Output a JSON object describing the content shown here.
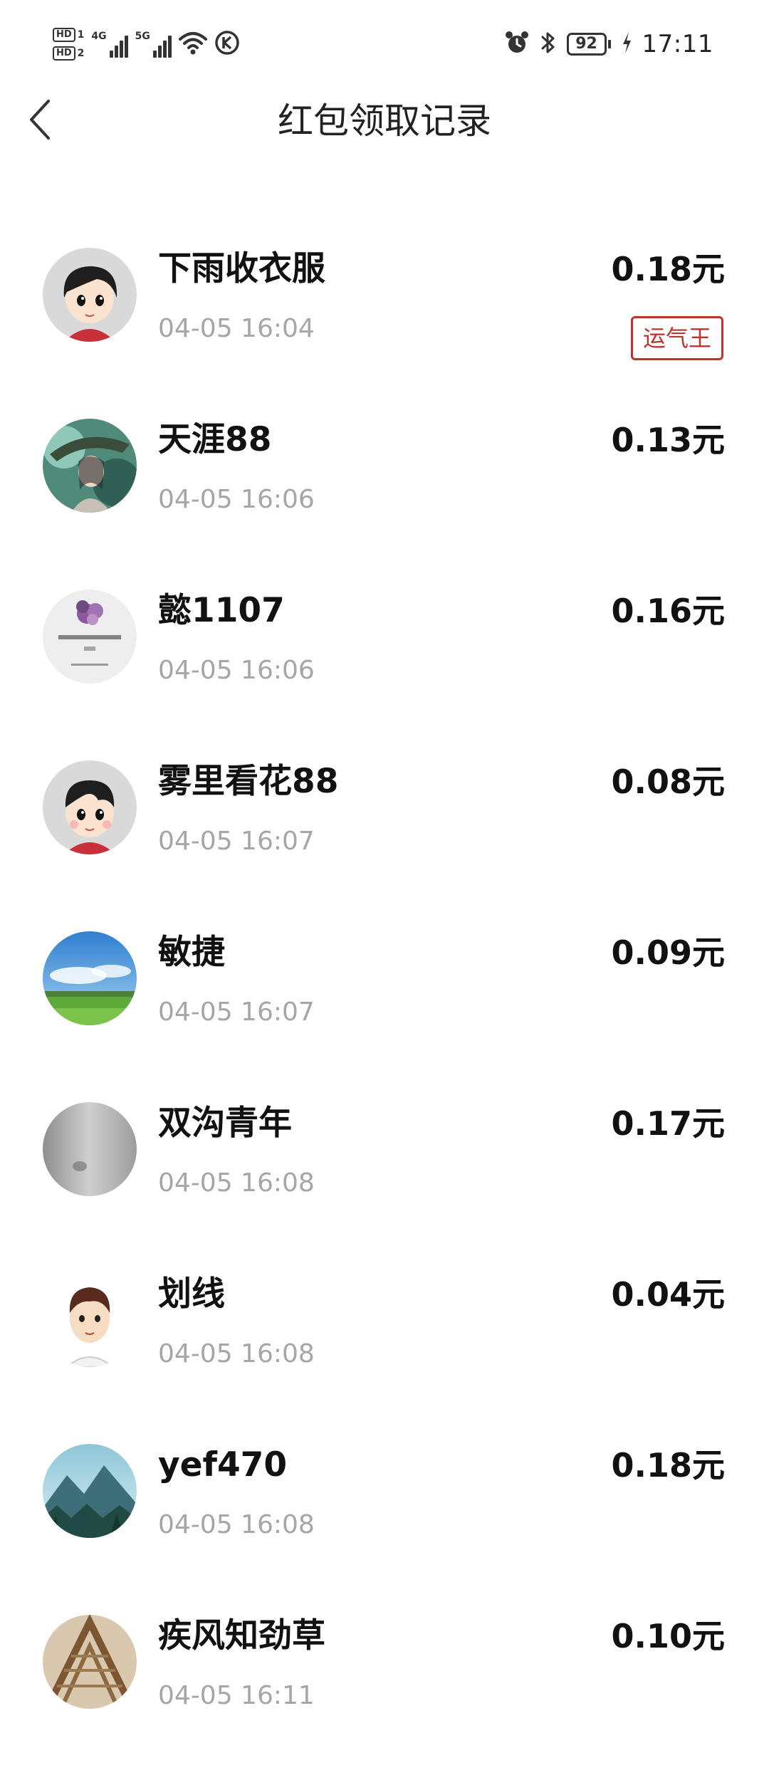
{
  "status_bar": {
    "sim1_label": "HD",
    "sim1_index": "1",
    "sim2_label": "HD",
    "sim2_index": "2",
    "net_4g": "4G",
    "net_5g": "5G",
    "battery_level": "92",
    "time": "17:11"
  },
  "header": {
    "title": "红包领取记录"
  },
  "colors": {
    "badge_red": "#c0322e",
    "time_gray": "#a6a6a6",
    "text_dark": "#111111"
  },
  "records": [
    {
      "name": "下雨收衣服",
      "time": "04-05 16:04",
      "amount": "0.18元",
      "badge": "运气王",
      "avatar": "cartoon-girl"
    },
    {
      "name": "天涯88",
      "time": "04-05 16:06",
      "amount": "0.13元",
      "avatar": "painting-portrait"
    },
    {
      "name": "懿1107",
      "time": "04-05 16:06",
      "amount": "0.16元",
      "avatar": "flower-card"
    },
    {
      "name": "雾里看花88",
      "time": "04-05 16:07",
      "amount": "0.08元",
      "avatar": "cartoon-boy"
    },
    {
      "name": "敏捷",
      "time": "04-05 16:07",
      "amount": "0.09元",
      "avatar": "sky-meadow"
    },
    {
      "name": "双沟青年",
      "time": "04-05 16:08",
      "amount": "0.17元",
      "avatar": "gray-photo"
    },
    {
      "name": "划线",
      "time": "04-05 16:08",
      "amount": "0.04元",
      "avatar": "cartoon-man"
    },
    {
      "name": "yef470",
      "time": "04-05 16:08",
      "amount": "0.18元",
      "avatar": "mountain-lake"
    },
    {
      "name": "疾风知劲草",
      "time": "04-05 16:11",
      "amount": "0.10元",
      "avatar": "wooden-frame"
    }
  ]
}
